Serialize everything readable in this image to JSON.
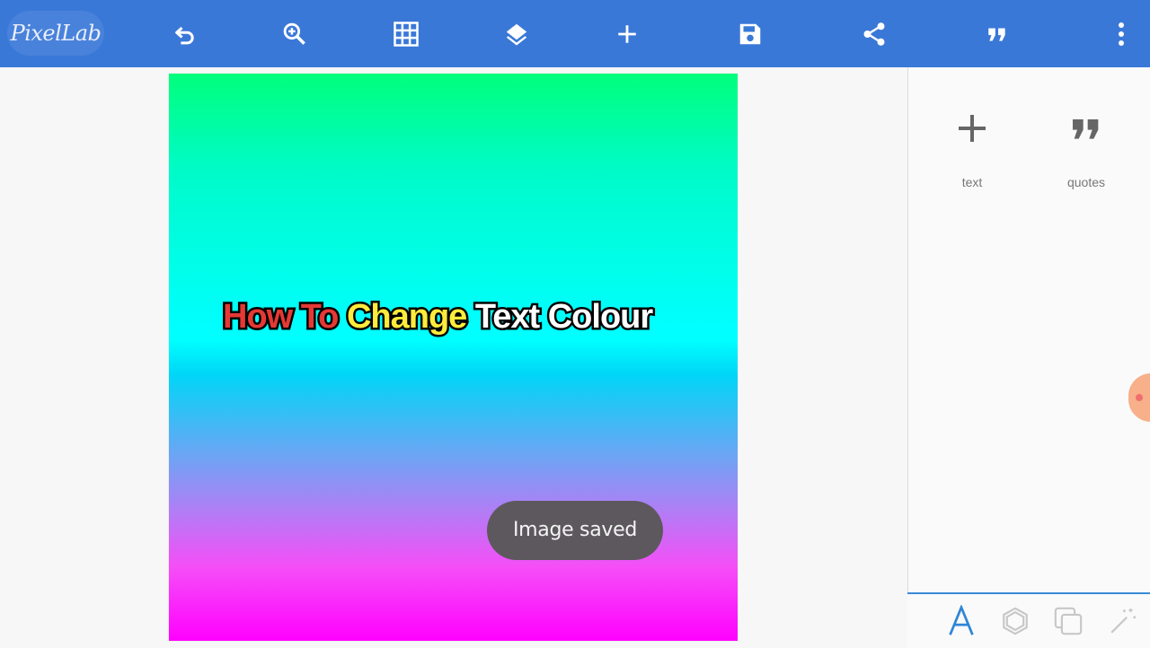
{
  "app": {
    "logo_text": "PixelLab"
  },
  "toolbar": {
    "icons": [
      "undo-icon",
      "zoom-in-icon",
      "grid-icon",
      "layers-icon",
      "add-icon",
      "save-icon",
      "share-icon",
      "quote-icon",
      "more-vert-icon"
    ]
  },
  "canvas": {
    "headline": {
      "word1": "How To",
      "word2": "Change",
      "word3": "Text Colour"
    },
    "gradient_top": "#00ff7c",
    "gradient_mid": "#00ffff",
    "gradient_bottom": "#ff00ff",
    "text_colors": {
      "word1": "#e53935",
      "word2": "#ffeb3b",
      "word3": "#ffffff",
      "stroke": "#000000"
    }
  },
  "toast": {
    "message": "Image saved"
  },
  "side_panel": {
    "items": [
      {
        "label": "text",
        "icon": "add-icon"
      },
      {
        "label": "quotes",
        "icon": "quote-icon"
      }
    ]
  },
  "bottom_bar": {
    "icons": [
      "text-icon",
      "shape-icon",
      "layer-copy-icon",
      "effects-icon"
    ],
    "accent": "#3a8bd8"
  },
  "colors": {
    "toolbar": "#3a78d8",
    "toast_bg": "#5d585e"
  }
}
